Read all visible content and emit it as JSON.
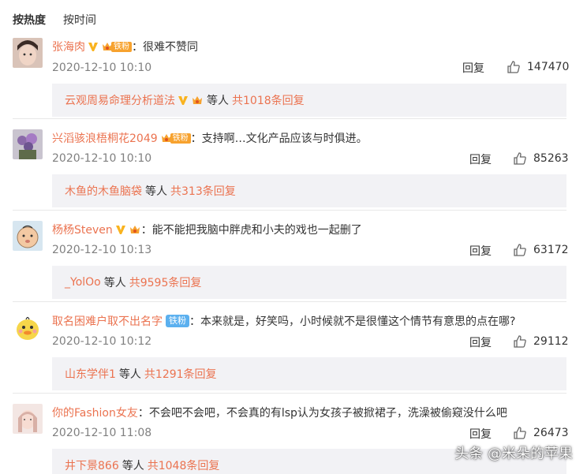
{
  "sort": {
    "hot": "按热度",
    "time": "按时间"
  },
  "comments": [
    {
      "user": "张海肉",
      "badge": "铁粉",
      "badge_style": "orange",
      "verified": true,
      "colon": "：",
      "text": "很难不赞同",
      "time": "2020-12-10 10:10",
      "reply": "回复",
      "likes": "147470",
      "sub_user": "云观周易命理分析道法",
      "sub_mid": "等人",
      "sub_count": "共1018条回复"
    },
    {
      "user": "兴滔骇浪梧桐花2049",
      "badge": "铁粉",
      "badge_style": "orange",
      "verified": false,
      "colon": "：",
      "text": "支持啊…文化产品应该与时俱进。",
      "time": "2020-12-10 10:10",
      "reply": "回复",
      "likes": "85263",
      "sub_user": "木鱼的木鱼脑袋",
      "sub_mid": "等人",
      "sub_count": "共313条回复"
    },
    {
      "user": "杨杨Steven",
      "badge": "",
      "badge_style": "crown",
      "verified": true,
      "colon": "：",
      "text": "能不能把我脑中胖虎和小夫的戏也一起删了",
      "time": "2020-12-10 10:13",
      "reply": "回复",
      "likes": "63172",
      "sub_user": "_YolOo",
      "sub_mid": "等人",
      "sub_count": "共9595条回复"
    },
    {
      "user": "取名困难户取不出名字",
      "badge": "铁粉",
      "badge_style": "blue",
      "verified": false,
      "colon": "：",
      "text": "本来就是，好笑吗，小时候就不是很懂这个情节有意思的点在哪?",
      "time": "2020-12-10 10:12",
      "reply": "回复",
      "likes": "29112",
      "sub_user": "山东学伴1",
      "sub_mid": "等人",
      "sub_count": "共1291条回复"
    },
    {
      "user": "你的Fashion女友",
      "badge": "",
      "badge_style": "none",
      "verified": false,
      "colon": "：",
      "text": "不会吧不会吧，不会真的有lsp认为女孩子被掀裙子，洗澡被偷窥没什么吧",
      "time": "2020-12-10 11:08",
      "reply": "回复",
      "likes": "26473",
      "sub_user": "井下景866",
      "sub_mid": "等人",
      "sub_count": "共1048条回复"
    }
  ],
  "watermark": "头条 @米朵的苹果",
  "colors": {
    "accent": "#eb7350",
    "badge_orange": "#f7a22e",
    "badge_blue": "#5bb0ef",
    "subbox_bg": "#f2f2f5"
  }
}
